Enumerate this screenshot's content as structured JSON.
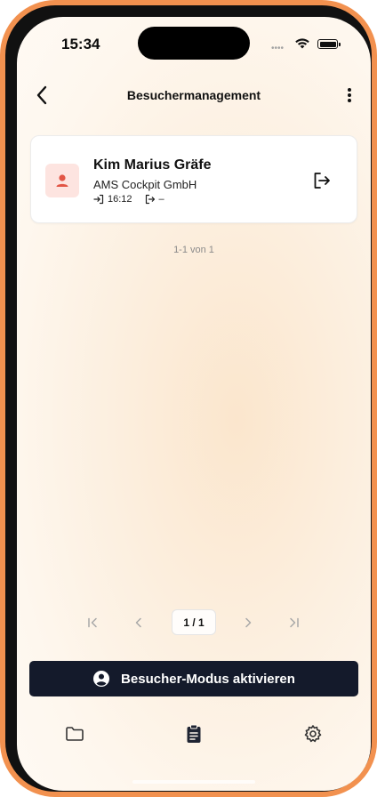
{
  "status_bar": {
    "time": "15:34",
    "signal": "••••"
  },
  "nav": {
    "title": "Besuchermanagement",
    "back_icon": "chevron-left-icon",
    "more_icon": "more-vertical-icon"
  },
  "visitor": {
    "name": "Kim Marius Gräfe",
    "company": "AMS Cockpit GmbH",
    "checkin_time": "16:12",
    "checkout_time": "–",
    "avatar_icon": "person-icon",
    "action_icon": "logout-icon"
  },
  "list": {
    "range_label": "1-1 von 1"
  },
  "pagination": {
    "current": "1 / 1"
  },
  "cta": {
    "label": "Besucher-Modus aktivieren",
    "icon": "user-circle-icon"
  },
  "tabs": [
    {
      "name": "documents",
      "icon": "folder-icon",
      "active": false
    },
    {
      "name": "visitors",
      "icon": "clipboard-icon",
      "active": true
    },
    {
      "name": "settings",
      "icon": "gear-icon",
      "active": false
    }
  ],
  "colors": {
    "frame": "#f2914f",
    "cta_background": "#141a2b",
    "avatar_background": "#fde4e0",
    "avatar_icon": "#e25545"
  }
}
